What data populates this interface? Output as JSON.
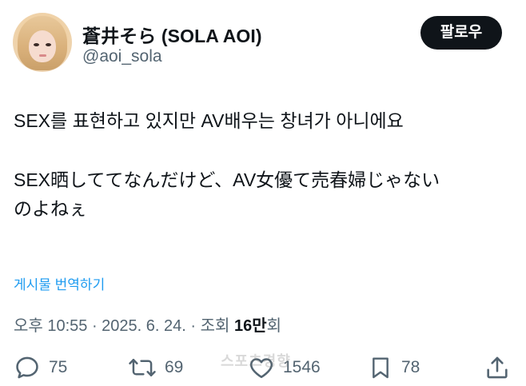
{
  "author": {
    "display_name": "蒼井そら (SOLA AOI)",
    "handle": "@aoi_sola"
  },
  "follow_label": "팔로우",
  "tweet": {
    "line_ko": "SEX를 표현하고 있지만 AV배우는 창녀가 아니에요",
    "line_ja_1": "SEX晒しててなんだけど、AV女優て売春婦じゃない",
    "line_ja_2": "のよねぇ"
  },
  "translate_label": "게시물 번역하기",
  "meta": {
    "timestamp": "오후 10:55 · 2025. 6. 24. · 조회 ",
    "views_count": "16만",
    "views_suffix": "회"
  },
  "actions": {
    "replies": "75",
    "reposts": "69",
    "likes": "1546",
    "bookmarks": "78"
  },
  "watermark": "스포츠경향",
  "icons": {
    "reply": "reply-icon",
    "repost": "repost-icon",
    "like": "heart-icon",
    "bookmark": "bookmark-icon",
    "share": "share-icon"
  },
  "colors": {
    "text": "#0f1419",
    "secondary": "#536471",
    "link": "#1d9bf0",
    "button_bg": "#0f1419"
  }
}
